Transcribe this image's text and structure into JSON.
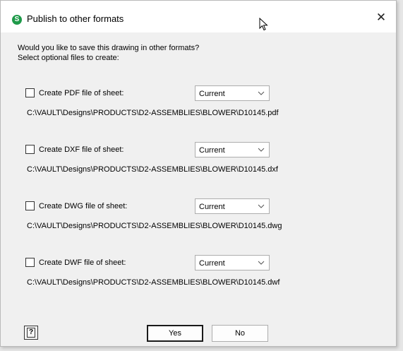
{
  "window": {
    "title": "Publish to other formats",
    "app_icon_letter": "S",
    "close_glyph": "✕"
  },
  "prompt": {
    "line1": "Would you like to save this drawing in other formats?",
    "line2": "Select optional files to create:"
  },
  "formats": [
    {
      "label": "Create PDF file of sheet:",
      "checked": false,
      "selected": "Current",
      "path": "C:\\VAULT\\Designs\\PRODUCTS\\D2-ASSEMBLIES\\BLOWER\\D10145.pdf"
    },
    {
      "label": "Create DXF file of sheet:",
      "checked": false,
      "selected": "Current",
      "path": "C:\\VAULT\\Designs\\PRODUCTS\\D2-ASSEMBLIES\\BLOWER\\D10145.dxf"
    },
    {
      "label": "Create DWG file of sheet:",
      "checked": false,
      "selected": "Current",
      "path": "C:\\VAULT\\Designs\\PRODUCTS\\D2-ASSEMBLIES\\BLOWER\\D10145.dwg"
    },
    {
      "label": "Create DWF file of sheet:",
      "checked": false,
      "selected": "Current",
      "path": "C:\\VAULT\\Designs\\PRODUCTS\\D2-ASSEMBLIES\\BLOWER\\D10145.dwf"
    }
  ],
  "buttons": {
    "help_glyph": "?",
    "yes_label": "Yes",
    "no_label": "No"
  },
  "colors": {
    "app_icon": "#1f9a4a",
    "dialog_bg": "#f0f0f0",
    "titlebar_bg": "#ffffff"
  }
}
